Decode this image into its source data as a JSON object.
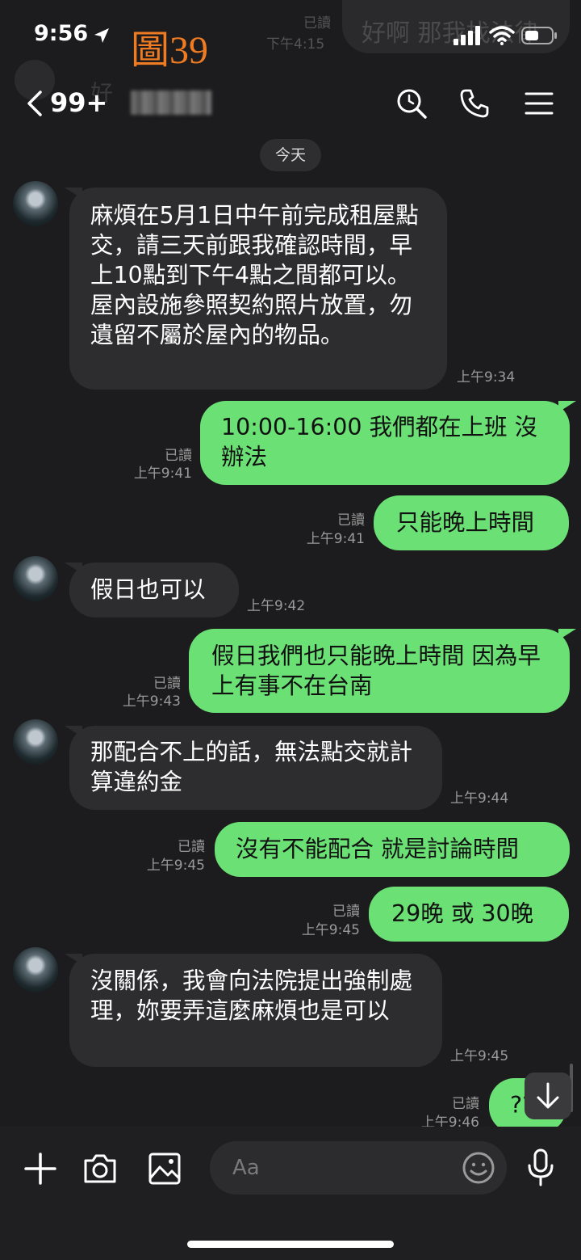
{
  "status": {
    "time": "9:56"
  },
  "overlay_label": "圖39",
  "ghost": {
    "read": "已讀",
    "time": "下午4:15",
    "text": "好啊 那我找法律",
    "reply": "好"
  },
  "header": {
    "unread_count": "99+",
    "contact_name": ""
  },
  "date_divider": "今天",
  "messages": [
    {
      "side": "in",
      "text": "麻煩在5月1日中午前完成租屋點交，請三天前跟我確認時間，早上10點到下午4點之間都可以。屋內設施參照契約照片放置，勿遺留不屬於屋內的物品。",
      "time": "上午9:34"
    },
    {
      "side": "out",
      "text": "10:00-16:00 我們都在上班 沒辦法",
      "read": "已讀",
      "time": "上午9:41"
    },
    {
      "side": "out",
      "text": "只能晚上時間",
      "read": "已讀",
      "time": "上午9:41"
    },
    {
      "side": "in",
      "text": "假日也可以",
      "time": "上午9:42"
    },
    {
      "side": "out",
      "text": "假日我們也只能晚上時間 因為早上有事不在台南",
      "read": "已讀",
      "time": "上午9:43"
    },
    {
      "side": "in",
      "text": "那配合不上的話，無法點交就計算違約金",
      "time": "上午9:44"
    },
    {
      "side": "out",
      "text": "沒有不能配合 就是討論時間",
      "read": "已讀",
      "time": "上午9:45"
    },
    {
      "side": "out",
      "text": "29晚 或 30晚",
      "read": "已讀",
      "time": "上午9:45"
    },
    {
      "side": "in",
      "text": "沒關係，我會向法院提出強制處理，妳要弄這麼麻煩也是可以",
      "time": "上午9:45"
    },
    {
      "side": "out",
      "text": "??",
      "read": "已讀",
      "time": "上午9:46"
    }
  ],
  "input": {
    "placeholder": "Aa"
  },
  "colors": {
    "outgoing_bubble": "#6ae075",
    "incoming_bubble": "#2d2d2f",
    "background": "#1c1c1e",
    "overlay_label": "#ef7b22"
  }
}
